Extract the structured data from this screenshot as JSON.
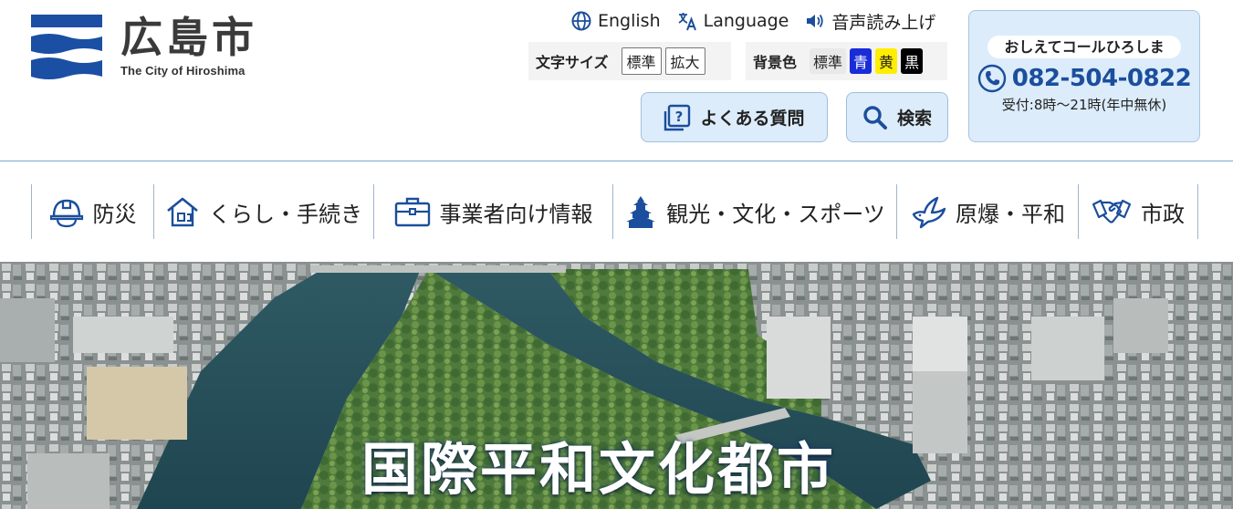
{
  "logo": {
    "name_ja": "広島市",
    "name_en": "The City of Hiroshima",
    "color": "#1a4fa3"
  },
  "utility": {
    "items": [
      {
        "label": "English",
        "icon": "globe-icon"
      },
      {
        "label": "Language",
        "icon": "translate-icon"
      },
      {
        "label": "音声読み上げ",
        "icon": "speaker-icon"
      }
    ]
  },
  "font_size": {
    "label": "文字サイズ",
    "options": [
      "標準",
      "拡大"
    ]
  },
  "bg_color": {
    "label": "背景色",
    "options": [
      {
        "label": "標準",
        "color": "#e9e9e9"
      },
      {
        "label": "青",
        "color": "#1a2cd8"
      },
      {
        "label": "黄",
        "color": "#ffee00"
      },
      {
        "label": "黒",
        "color": "#000000"
      }
    ]
  },
  "actions": {
    "faq_label": "よくある質問",
    "search_label": "検索"
  },
  "call_center": {
    "title": "おしえてコールひろしま",
    "phone": "082-504-0822",
    "hours": "受付:8時～21時(年中無休)"
  },
  "nav": {
    "items": [
      {
        "label": "防災",
        "icon": "helmet-icon"
      },
      {
        "label": "くらし・手続き",
        "icon": "house-icon"
      },
      {
        "label": "事業者向け情報",
        "icon": "briefcase-icon"
      },
      {
        "label": "観光・文化・スポーツ",
        "icon": "castle-icon"
      },
      {
        "label": "原爆・平和",
        "icon": "dove-icon"
      },
      {
        "label": "市政",
        "icon": "handshake-icon"
      }
    ]
  },
  "hero": {
    "title": "国際平和文化都市"
  },
  "colors": {
    "accent": "#1b4e9c",
    "button_bg": "#dcecfb",
    "nav_divider": "#9fb5cc"
  }
}
